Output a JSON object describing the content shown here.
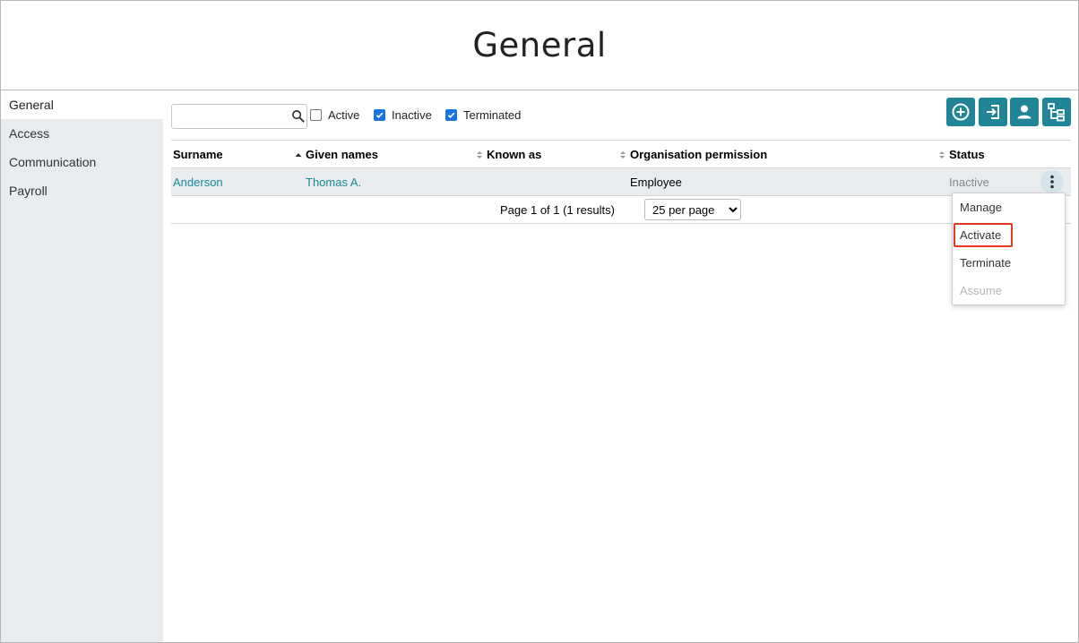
{
  "header": {
    "title": "General"
  },
  "sidebar": {
    "items": [
      {
        "label": "General"
      },
      {
        "label": "Access"
      },
      {
        "label": "Communication"
      },
      {
        "label": "Payroll"
      }
    ]
  },
  "toolbar": {
    "search": {
      "value": "",
      "placeholder": ""
    },
    "filters": [
      {
        "label": "Active",
        "checked": false
      },
      {
        "label": "Inactive",
        "checked": true
      },
      {
        "label": "Terminated",
        "checked": true
      }
    ],
    "buttons": [
      {
        "icon": "add-circle-icon"
      },
      {
        "icon": "sign-in-icon"
      },
      {
        "icon": "person-icon"
      },
      {
        "icon": "org-tree-icon"
      }
    ],
    "accent_color": "#208597"
  },
  "table": {
    "columns": [
      "Surname",
      "Given names",
      "Known as",
      "Organisation permission",
      "Status"
    ],
    "sorted_column": "Given names",
    "rows": [
      {
        "surname": "Anderson",
        "given_names": "Thomas A.",
        "known_as": "",
        "organisation_permission": "Employee",
        "status": "Inactive"
      }
    ]
  },
  "pagination": {
    "info": "Page 1 of 1 (1 results)",
    "per_page": "25 per page"
  },
  "row_menu": {
    "items": [
      {
        "label": "Manage",
        "disabled": false
      },
      {
        "label": "Activate",
        "disabled": false,
        "highlighted": true
      },
      {
        "label": "Terminate",
        "disabled": false
      },
      {
        "label": "Assume",
        "disabled": true
      }
    ],
    "highlight_color": "#e23a1e"
  }
}
